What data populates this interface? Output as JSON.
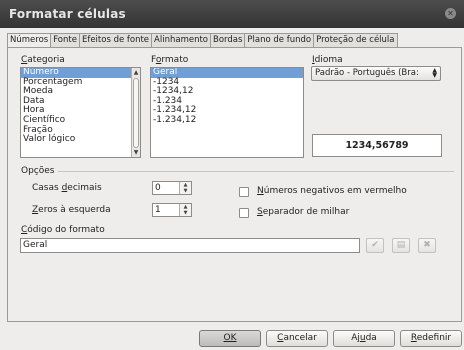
{
  "window": {
    "title": "Formatar células"
  },
  "tabs": [
    "Números",
    "Fonte",
    "Efeitos de fonte",
    "Alinhamento",
    "Bordas",
    "Plano de fundo",
    "Proteção de célula"
  ],
  "category": {
    "label": "Categoria",
    "items": [
      "Número",
      "Porcentagem",
      "Moeda",
      "Data",
      "Hora",
      "Científico",
      "Fração",
      "Valor lógico"
    ],
    "selected": "Número"
  },
  "format": {
    "label": "Formato",
    "items": [
      "Geral",
      "-1234",
      "-1234,12",
      "-1.234",
      "-1.234,12",
      "-1.234,12"
    ],
    "selected": "Geral"
  },
  "language": {
    "label": "Idioma",
    "value": "Padrão - Português (Bra:"
  },
  "preview": {
    "value": "1234,56789"
  },
  "options": {
    "label": "Opções",
    "decimal_places": {
      "label": "Casas decimais",
      "value": "0"
    },
    "leading_zeros": {
      "label": "Zeros à esquerda",
      "value": "1"
    },
    "negative_red": {
      "label": "Números negativos em vermelho",
      "checked": false
    },
    "thousands_sep": {
      "label": "Separador de milhar",
      "checked": false
    }
  },
  "format_code": {
    "label": "Código do formato",
    "value": "Geral"
  },
  "buttons": {
    "ok": "OK",
    "cancel": "Cancelar",
    "help": "Ajuda",
    "reset": "Redefinir"
  },
  "colors": {
    "title_bg": "#3c3c3c",
    "selection": "#6f9fd6",
    "dialog_bg": "#efedeb"
  }
}
